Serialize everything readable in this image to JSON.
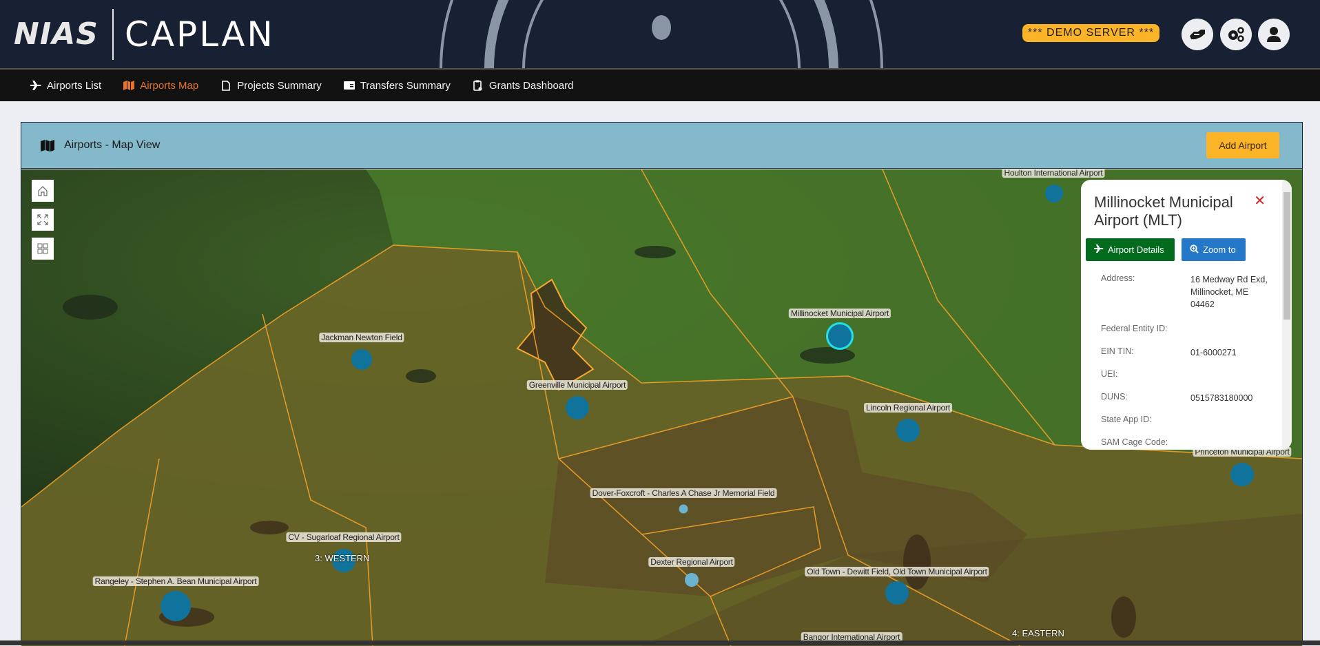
{
  "header": {
    "logo_left": "NIAS",
    "logo_right": "CAPLAN",
    "demo_badge": "*** DEMO SERVER ***",
    "buttons": [
      {
        "name": "handshake",
        "icon": "handshake-icon"
      },
      {
        "name": "settings",
        "icon": "gears-icon"
      },
      {
        "name": "user",
        "icon": "user-icon"
      }
    ]
  },
  "nav": {
    "items": [
      {
        "label": "Airports List",
        "icon": "plane-icon",
        "active": false
      },
      {
        "label": "Airports Map",
        "icon": "map-icon",
        "active": true
      },
      {
        "label": "Projects Summary",
        "icon": "file-icon",
        "active": false
      },
      {
        "label": "Transfers Summary",
        "icon": "money-check-icon",
        "active": false
      },
      {
        "label": "Grants Dashboard",
        "icon": "clipboard-icon",
        "active": false
      }
    ]
  },
  "card": {
    "title": "Airports - Map View",
    "add_button": "Add Airport"
  },
  "map": {
    "controls": [
      "home",
      "fullscreen",
      "basemap-gallery"
    ],
    "airports": [
      {
        "name": "Houlton International Airport",
        "style": "normal"
      },
      {
        "name": "Millinocket Municipal Airport",
        "style": "selected"
      },
      {
        "name": "Jackman Newton Field",
        "style": "normal"
      },
      {
        "name": "Greenville Municipal Airport",
        "style": "normal"
      },
      {
        "name": "Lincoln Regional Airport",
        "style": "normal"
      },
      {
        "name": "Princeton Municipal Airport",
        "style": "normal"
      },
      {
        "name": "Dover-Foxcroft - Charles A Chase Jr Memorial Field",
        "style": "light"
      },
      {
        "name": "CV - Sugarloaf Regional Airport",
        "style": "normal"
      },
      {
        "name": "Dexter Regional Airport",
        "style": "light"
      },
      {
        "name": "Old Town - Dewitt Field, Old Town Municipal Airport",
        "style": "normal"
      },
      {
        "name": "Rangeley - Stephen A. Bean Municipal Airport",
        "style": "normal"
      },
      {
        "name": "Bangor International Airport",
        "style": "normal"
      }
    ],
    "regions": [
      "3: WESTERN",
      "4: EASTERN"
    ]
  },
  "popup": {
    "title": "Millinocket Municipal Airport (MLT)",
    "details_button": "Airport Details",
    "zoom_button": "Zoom to",
    "fields": [
      {
        "label": "Address:",
        "value": "16 Medway Rd Exd, Millinocket, ME 04462"
      },
      {
        "label": "Federal Entity ID:",
        "value": ""
      },
      {
        "label": "EIN TIN:",
        "value": "01-6000271"
      },
      {
        "label": "UEI:",
        "value": ""
      },
      {
        "label": "DUNS:",
        "value": "0515783180000"
      },
      {
        "label": "State App ID:",
        "value": ""
      },
      {
        "label": "SAM Cage Code:",
        "value": ""
      }
    ]
  },
  "colors": {
    "topbar": "#172133",
    "accent_orange": "#e8742a",
    "badge_yellow": "#fbb427",
    "card_header": "#84b8cb",
    "airport_dot": "#10739c",
    "selected_ring": "#22e0e8",
    "details_green": "#036b1e",
    "zoom_blue": "#2577c7"
  }
}
